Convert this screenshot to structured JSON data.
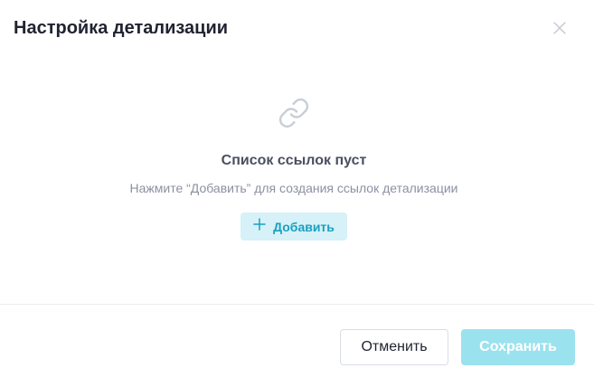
{
  "dialog": {
    "title": "Настройка детализации",
    "close_icon": "close-icon"
  },
  "empty_state": {
    "icon": "link-icon",
    "title": "Список ссылок пуст",
    "subtitle": "Нажмите “Добавить” для создания ссылок детализации",
    "add_button": {
      "icon": "plus-icon",
      "label": "Добавить"
    }
  },
  "footer": {
    "cancel_label": "Отменить",
    "save_label": "Сохранить",
    "save_disabled": true
  },
  "colors": {
    "accent": "#1a9fc0",
    "accent_light": "#d6f1f7",
    "save_disabled_bg": "#9be2ef",
    "title_text": "#1f2331",
    "muted_text": "#8b91a1"
  }
}
